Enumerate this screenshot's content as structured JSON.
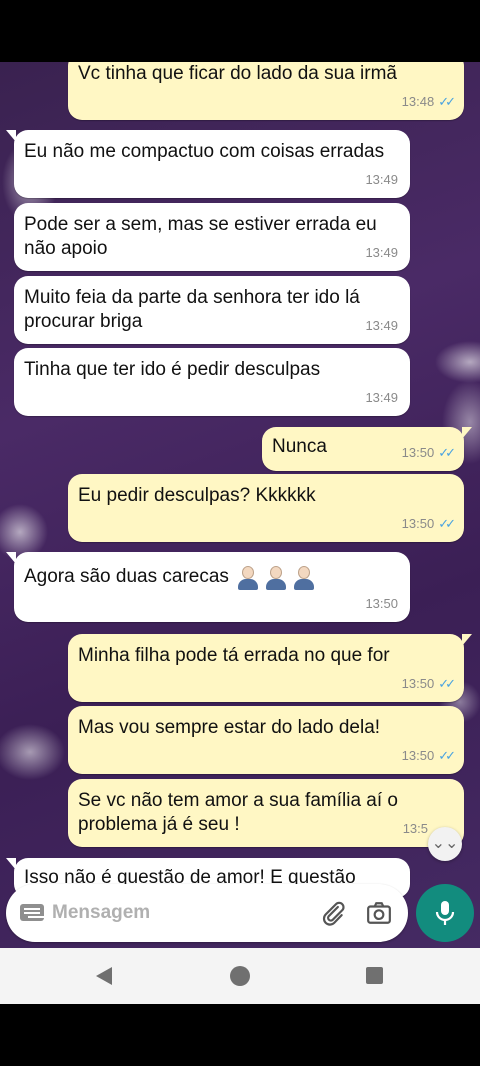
{
  "messages": [
    {
      "dir": "out",
      "text": "Vc tinha que ficar do lado da sua irmã",
      "time": "13:48",
      "read": true
    },
    {
      "dir": "in",
      "text": "Eu não me compactuo com coisas erradas",
      "time": "13:49"
    },
    {
      "dir": "in",
      "text": "Pode ser a sem, mas se estiver errada eu não apoio",
      "time": "13:49"
    },
    {
      "dir": "in",
      "text": "Muito feia da parte da senhora ter ido lá procurar briga",
      "time": "13:49"
    },
    {
      "dir": "in",
      "text": "Tinha que ter ido é pedir desculpas",
      "time": "13:49"
    },
    {
      "dir": "out",
      "text": "Nunca",
      "time": "13:50",
      "read": true
    },
    {
      "dir": "out",
      "text": "Eu pedir desculpas? Kkkkkk",
      "time": "13:50",
      "read": true
    },
    {
      "dir": "in",
      "text": "Agora são duas carecas",
      "emoji": "man-facepalming x3",
      "time": "13:50"
    },
    {
      "dir": "out",
      "text": "Minha filha pode tá errada no que for",
      "time": "13:50",
      "read": true
    },
    {
      "dir": "out",
      "text": "Mas vou sempre estar do lado dela!",
      "time": "13:50",
      "read": true
    },
    {
      "dir": "out",
      "text": "Se vc não tem amor a sua família aí o problema já é seu !",
      "time": "13:5"
    },
    {
      "dir": "in",
      "text": "Isso não é questão de amor! E questão"
    }
  ],
  "composer": {
    "placeholder": "Mensagem",
    "icons": [
      "keyboard-icon",
      "attach-icon",
      "camera-icon",
      "mic-icon"
    ]
  },
  "colors": {
    "incoming": "#ffffff",
    "outgoing": "#fff7c4",
    "accent": "#128c7e",
    "read_ticks": "#4aa3e0"
  },
  "ticks": "✓✓",
  "scroll_icon": "⌄⌄"
}
